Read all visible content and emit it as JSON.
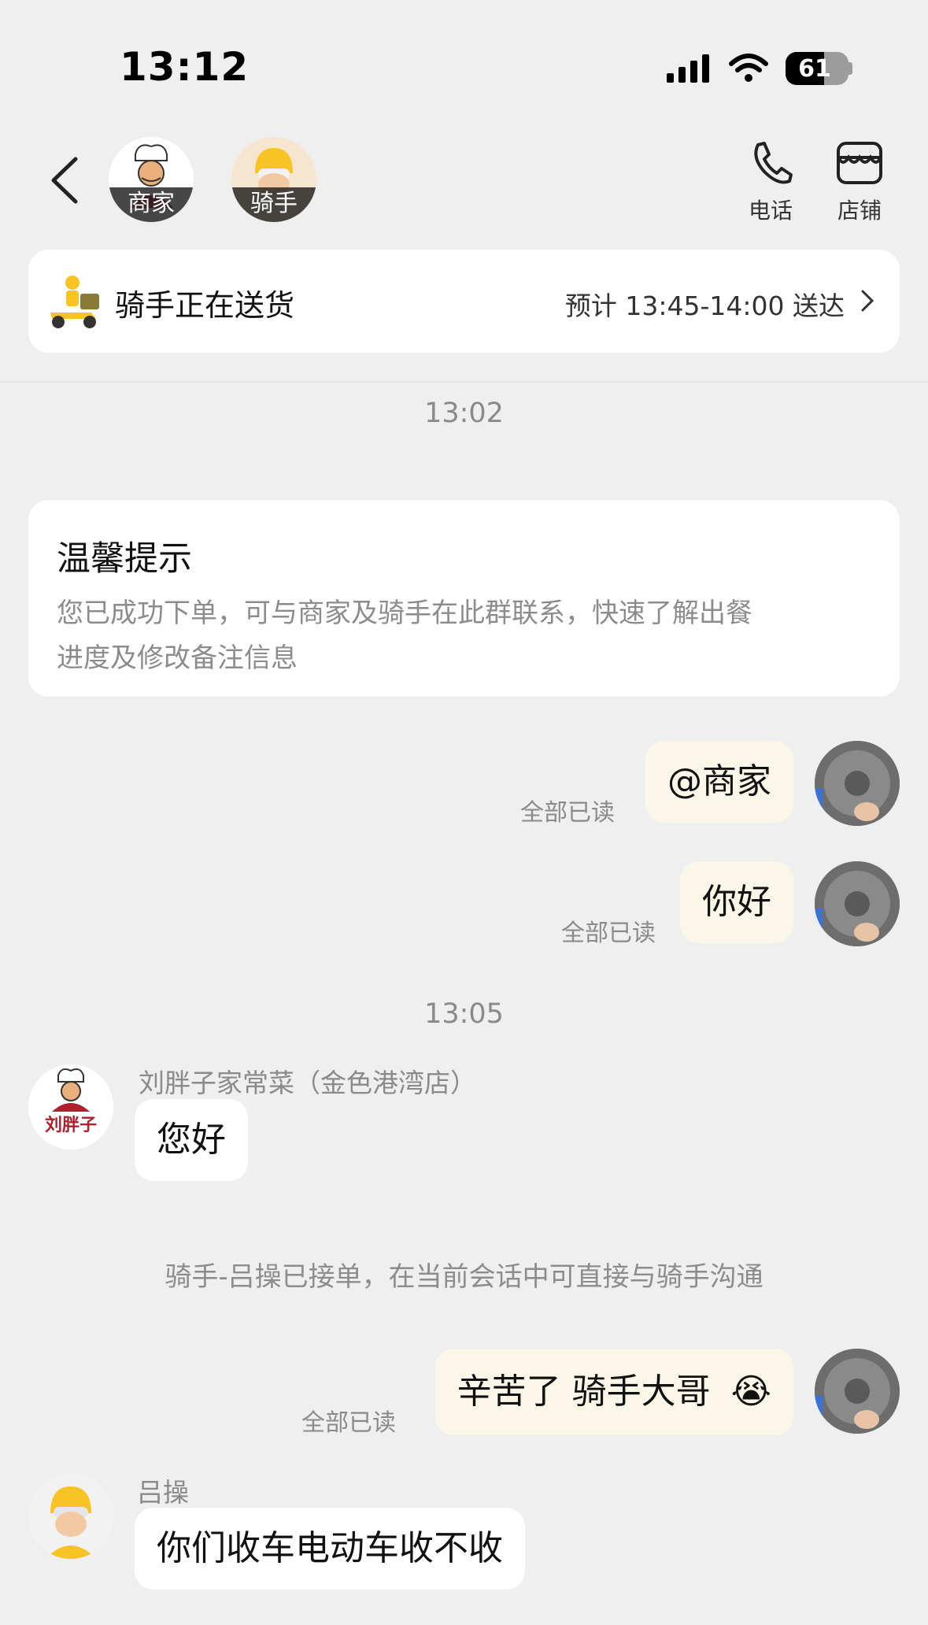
{
  "status_bar": {
    "time": "13:12",
    "battery": "61",
    "battery_level": 0.61
  },
  "header": {
    "merchant_tag": "商家",
    "rider_tag": "骑手",
    "phone_label": "电话",
    "shop_label": "店铺",
    "icons": [
      "back-arrow-icon",
      "phone-icon",
      "shop-icon"
    ]
  },
  "delivery": {
    "title": "骑手正在送货",
    "eta": "预计 13:45-14:00 送达"
  },
  "timestamps": {
    "t1": "13:02",
    "t2": "13:05"
  },
  "tips": {
    "title": "温馨提示",
    "line1": "您已成功下单，可与商家及骑手在此群联系，快速了解出餐",
    "line2": "进度及修改备注信息"
  },
  "messages": {
    "m1": {
      "text": "@商家",
      "status": "全部已读"
    },
    "m2": {
      "text": "你好",
      "status": "全部已读"
    },
    "m3": {
      "sender": "刘胖子家常菜（金色港湾店）",
      "text": "您好",
      "avatar_text": "刘胖子"
    },
    "system": "骑手-吕操已接单，在当前会话中可直接与骑手沟通",
    "m4": {
      "text": "辛苦了 骑手大哥",
      "status": "全部已读",
      "emoji": "😭"
    },
    "m5": {
      "sender": "吕操",
      "text": "你们收车电动车收不收"
    }
  },
  "colors": {
    "background": "#efefef",
    "my_bubble": "#fbf7e8",
    "their_bubble": "#ffffff",
    "muted_text": "#8a8a8a"
  }
}
